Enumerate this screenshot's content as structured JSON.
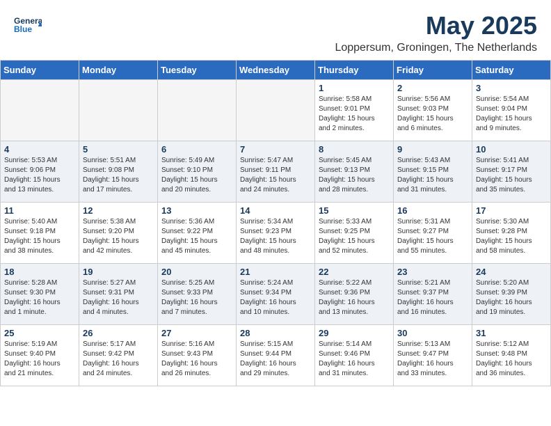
{
  "header": {
    "logo_general": "General",
    "logo_blue": "Blue",
    "month": "May 2025",
    "location": "Loppersum, Groningen, The Netherlands"
  },
  "days_of_week": [
    "Sunday",
    "Monday",
    "Tuesday",
    "Wednesday",
    "Thursday",
    "Friday",
    "Saturday"
  ],
  "weeks": [
    [
      {
        "day": "",
        "info": ""
      },
      {
        "day": "",
        "info": ""
      },
      {
        "day": "",
        "info": ""
      },
      {
        "day": "",
        "info": ""
      },
      {
        "day": "1",
        "info": "Sunrise: 5:58 AM\nSunset: 9:01 PM\nDaylight: 15 hours\nand 2 minutes."
      },
      {
        "day": "2",
        "info": "Sunrise: 5:56 AM\nSunset: 9:03 PM\nDaylight: 15 hours\nand 6 minutes."
      },
      {
        "day": "3",
        "info": "Sunrise: 5:54 AM\nSunset: 9:04 PM\nDaylight: 15 hours\nand 9 minutes."
      }
    ],
    [
      {
        "day": "4",
        "info": "Sunrise: 5:53 AM\nSunset: 9:06 PM\nDaylight: 15 hours\nand 13 minutes."
      },
      {
        "day": "5",
        "info": "Sunrise: 5:51 AM\nSunset: 9:08 PM\nDaylight: 15 hours\nand 17 minutes."
      },
      {
        "day": "6",
        "info": "Sunrise: 5:49 AM\nSunset: 9:10 PM\nDaylight: 15 hours\nand 20 minutes."
      },
      {
        "day": "7",
        "info": "Sunrise: 5:47 AM\nSunset: 9:11 PM\nDaylight: 15 hours\nand 24 minutes."
      },
      {
        "day": "8",
        "info": "Sunrise: 5:45 AM\nSunset: 9:13 PM\nDaylight: 15 hours\nand 28 minutes."
      },
      {
        "day": "9",
        "info": "Sunrise: 5:43 AM\nSunset: 9:15 PM\nDaylight: 15 hours\nand 31 minutes."
      },
      {
        "day": "10",
        "info": "Sunrise: 5:41 AM\nSunset: 9:17 PM\nDaylight: 15 hours\nand 35 minutes."
      }
    ],
    [
      {
        "day": "11",
        "info": "Sunrise: 5:40 AM\nSunset: 9:18 PM\nDaylight: 15 hours\nand 38 minutes."
      },
      {
        "day": "12",
        "info": "Sunrise: 5:38 AM\nSunset: 9:20 PM\nDaylight: 15 hours\nand 42 minutes."
      },
      {
        "day": "13",
        "info": "Sunrise: 5:36 AM\nSunset: 9:22 PM\nDaylight: 15 hours\nand 45 minutes."
      },
      {
        "day": "14",
        "info": "Sunrise: 5:34 AM\nSunset: 9:23 PM\nDaylight: 15 hours\nand 48 minutes."
      },
      {
        "day": "15",
        "info": "Sunrise: 5:33 AM\nSunset: 9:25 PM\nDaylight: 15 hours\nand 52 minutes."
      },
      {
        "day": "16",
        "info": "Sunrise: 5:31 AM\nSunset: 9:27 PM\nDaylight: 15 hours\nand 55 minutes."
      },
      {
        "day": "17",
        "info": "Sunrise: 5:30 AM\nSunset: 9:28 PM\nDaylight: 15 hours\nand 58 minutes."
      }
    ],
    [
      {
        "day": "18",
        "info": "Sunrise: 5:28 AM\nSunset: 9:30 PM\nDaylight: 16 hours\nand 1 minute."
      },
      {
        "day": "19",
        "info": "Sunrise: 5:27 AM\nSunset: 9:31 PM\nDaylight: 16 hours\nand 4 minutes."
      },
      {
        "day": "20",
        "info": "Sunrise: 5:25 AM\nSunset: 9:33 PM\nDaylight: 16 hours\nand 7 minutes."
      },
      {
        "day": "21",
        "info": "Sunrise: 5:24 AM\nSunset: 9:34 PM\nDaylight: 16 hours\nand 10 minutes."
      },
      {
        "day": "22",
        "info": "Sunrise: 5:22 AM\nSunset: 9:36 PM\nDaylight: 16 hours\nand 13 minutes."
      },
      {
        "day": "23",
        "info": "Sunrise: 5:21 AM\nSunset: 9:37 PM\nDaylight: 16 hours\nand 16 minutes."
      },
      {
        "day": "24",
        "info": "Sunrise: 5:20 AM\nSunset: 9:39 PM\nDaylight: 16 hours\nand 19 minutes."
      }
    ],
    [
      {
        "day": "25",
        "info": "Sunrise: 5:19 AM\nSunset: 9:40 PM\nDaylight: 16 hours\nand 21 minutes."
      },
      {
        "day": "26",
        "info": "Sunrise: 5:17 AM\nSunset: 9:42 PM\nDaylight: 16 hours\nand 24 minutes."
      },
      {
        "day": "27",
        "info": "Sunrise: 5:16 AM\nSunset: 9:43 PM\nDaylight: 16 hours\nand 26 minutes."
      },
      {
        "day": "28",
        "info": "Sunrise: 5:15 AM\nSunset: 9:44 PM\nDaylight: 16 hours\nand 29 minutes."
      },
      {
        "day": "29",
        "info": "Sunrise: 5:14 AM\nSunset: 9:46 PM\nDaylight: 16 hours\nand 31 minutes."
      },
      {
        "day": "30",
        "info": "Sunrise: 5:13 AM\nSunset: 9:47 PM\nDaylight: 16 hours\nand 33 minutes."
      },
      {
        "day": "31",
        "info": "Sunrise: 5:12 AM\nSunset: 9:48 PM\nDaylight: 16 hours\nand 36 minutes."
      }
    ]
  ]
}
